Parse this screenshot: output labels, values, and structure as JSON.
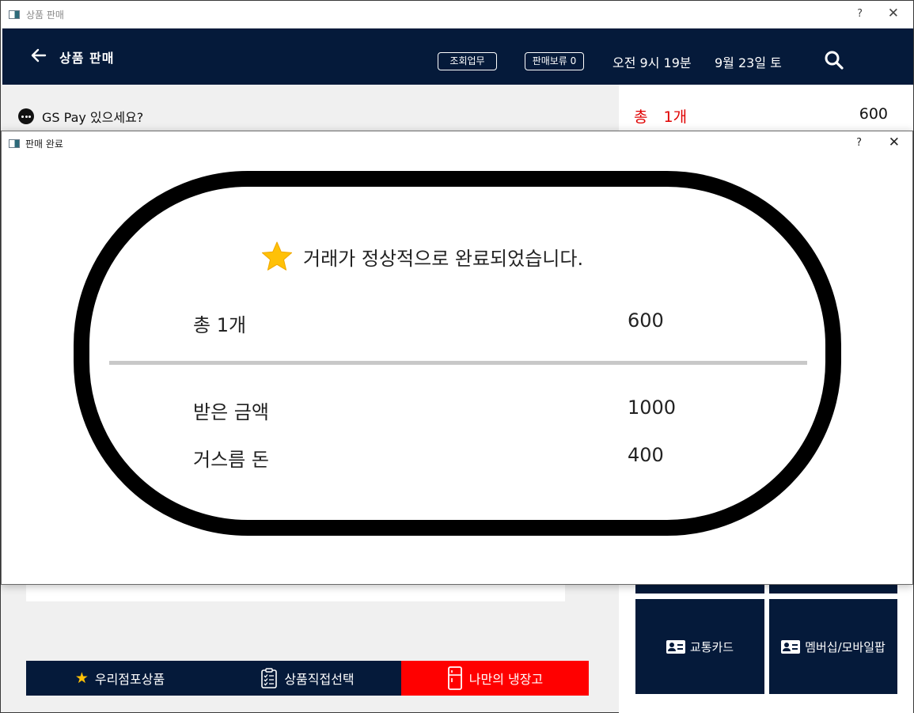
{
  "window": {
    "title": "상품 판매",
    "help": "?",
    "close": "✕"
  },
  "header": {
    "title": "상품 판매",
    "inquiry_button": "조회업무",
    "hold_button": "판매보류 0",
    "time": "오전 9시 19분",
    "date": "9월 23일 토"
  },
  "gspay": {
    "text": "GS Pay 있으세요?"
  },
  "summary": {
    "total_label": "총",
    "count": "1개",
    "amount": "600"
  },
  "grid_buttons": {
    "transport": "교통카드",
    "membership": "멤버십/모바일팝"
  },
  "bottom_tabs": {
    "store_products": "우리점포상품",
    "direct_select": "상품직접선택",
    "my_fridge": "나만의 냉장고"
  },
  "dialog": {
    "title": "판매 완료",
    "help": "?",
    "close": "✕",
    "message": "거래가 정상적으로 완료되었습니다.",
    "total_label": "총 1개",
    "total_value": "600",
    "received_label": "받은 금액",
    "received_value": "1000",
    "change_label": "거스름 돈",
    "change_value": "400"
  },
  "colors": {
    "navy": "#051a3a",
    "red": "#ff0000",
    "star": "#ffc107"
  }
}
